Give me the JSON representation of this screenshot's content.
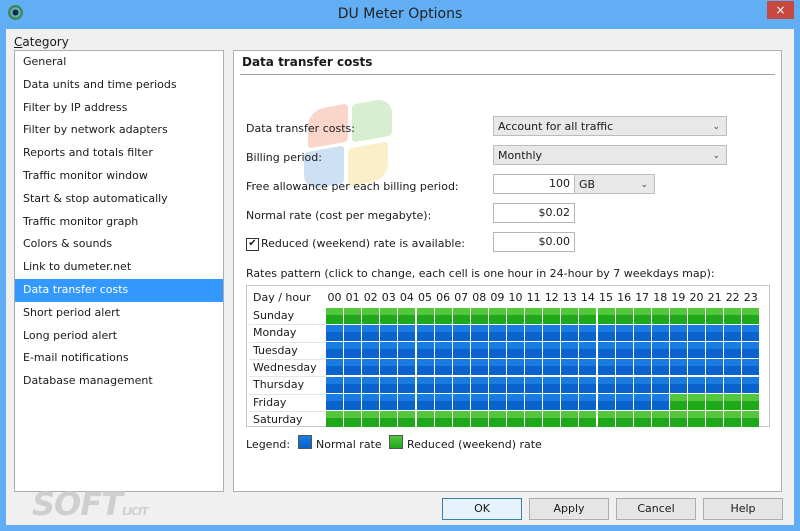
{
  "window": {
    "title": "DU Meter Options",
    "close_glyph": "×"
  },
  "sidebar": {
    "label_first": "C",
    "label_rest": "ategory",
    "items": [
      {
        "label": "General",
        "selected": false
      },
      {
        "label": "Data units and time periods",
        "selected": false
      },
      {
        "label": "Filter by IP address",
        "selected": false
      },
      {
        "label": "Filter by network adapters",
        "selected": false
      },
      {
        "label": "Reports and totals filter",
        "selected": false
      },
      {
        "label": "Traffic monitor window",
        "selected": false
      },
      {
        "label": "Start & stop automatically",
        "selected": false
      },
      {
        "label": "Traffic monitor graph",
        "selected": false
      },
      {
        "label": "Colors & sounds",
        "selected": false
      },
      {
        "label": "Link to dumeter.net",
        "selected": false
      },
      {
        "label": "Data transfer costs",
        "selected": true
      },
      {
        "label": "Short period alert",
        "selected": false
      },
      {
        "label": "Long period alert",
        "selected": false
      },
      {
        "label": "E-mail notifications",
        "selected": false
      },
      {
        "label": "Database management",
        "selected": false
      }
    ]
  },
  "panel": {
    "title": "Data transfer costs",
    "fields": {
      "costs_label": "Data transfer costs:",
      "costs_value": "Account for all traffic",
      "billing_label": "Billing period:",
      "billing_value": "Monthly",
      "allowance_label": "Free allowance per each billing period:",
      "allowance_value": "100",
      "allowance_unit": "GB",
      "normal_rate_label": "Normal rate (cost per megabyte):",
      "normal_rate_value": "$0.02",
      "reduced_label": "Reduced (weekend) rate is available:",
      "reduced_checked": true,
      "reduced_value": "$0.00"
    },
    "rates_pattern": {
      "label": "Rates pattern (click to change, each cell is one hour in 24-hour by 7 weekdays map):",
      "header": "Day / hour",
      "hours": [
        "00",
        "01",
        "02",
        "03",
        "04",
        "05",
        "06",
        "07",
        "08",
        "09",
        "10",
        "11",
        "12",
        "13",
        "14",
        "15",
        "16",
        "17",
        "18",
        "19",
        "20",
        "21",
        "22",
        "23"
      ],
      "days": [
        {
          "name": "Sunday",
          "reduced_hours": "all"
        },
        {
          "name": "Monday",
          "reduced_hours": "none"
        },
        {
          "name": "Tuesday",
          "reduced_hours": "none"
        },
        {
          "name": "Wednesday",
          "reduced_hours": "none"
        },
        {
          "name": "Thursday",
          "reduced_hours": "none"
        },
        {
          "name": "Friday",
          "reduced_hours": "19-23"
        },
        {
          "name": "Saturday",
          "reduced_hours": "all"
        }
      ]
    },
    "legend": {
      "label": "Legend:",
      "normal": "Normal rate",
      "reduced": "Reduced (weekend) rate",
      "normal_color": "#0a62cc",
      "reduced_color": "#1fa81a"
    }
  },
  "buttons": {
    "ok": "OK",
    "apply": "Apply",
    "cancel": "Cancel",
    "help": "Help"
  },
  "watermark": {
    "text": "SOFT",
    "sub": "LICIT"
  }
}
